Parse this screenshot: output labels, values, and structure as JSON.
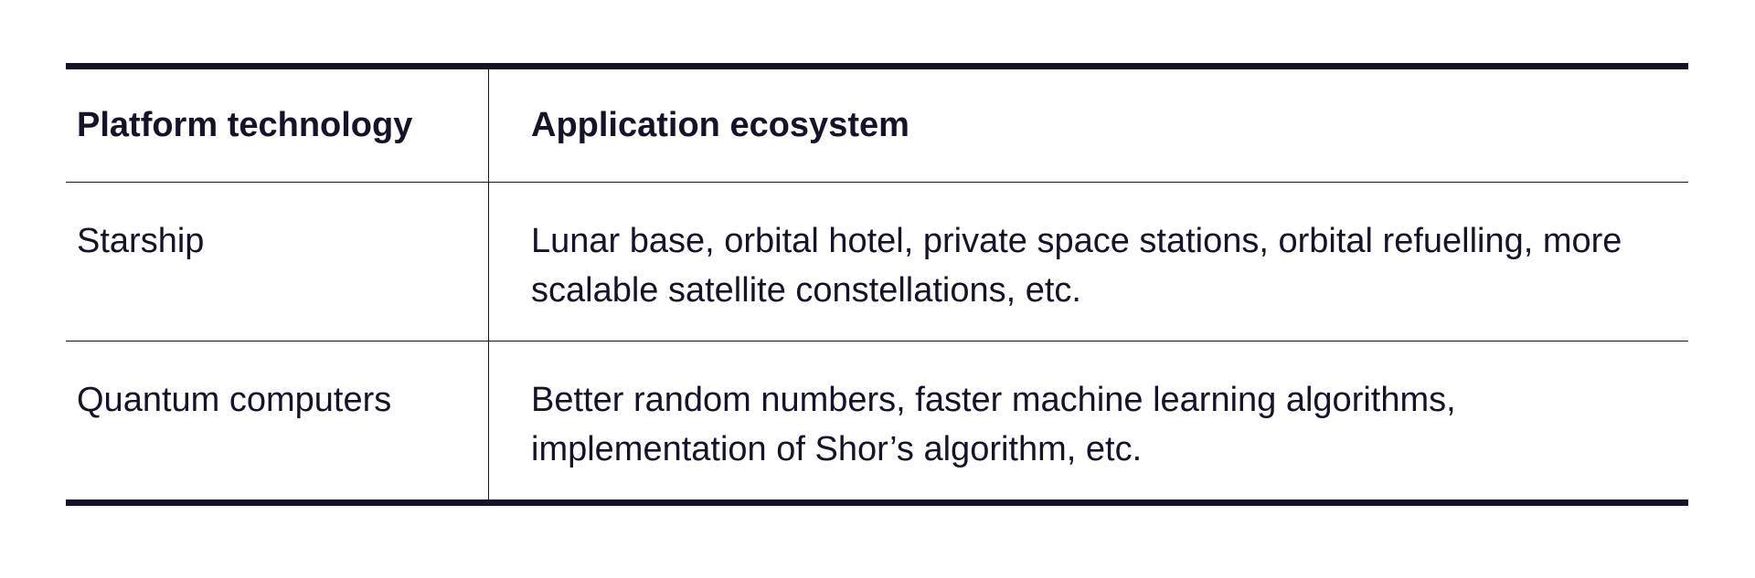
{
  "table": {
    "headers": [
      "Platform technology",
      "Application ecosystem"
    ],
    "rows": [
      [
        "Starship",
        "Lunar base, orbital hotel, private space stations, orbital refuelling, more scalable satellite constellations, etc."
      ],
      [
        "Quantum computers",
        "Better random numbers, faster machine learning algorithms, implementation of Shor’s algorithm, etc."
      ]
    ]
  }
}
